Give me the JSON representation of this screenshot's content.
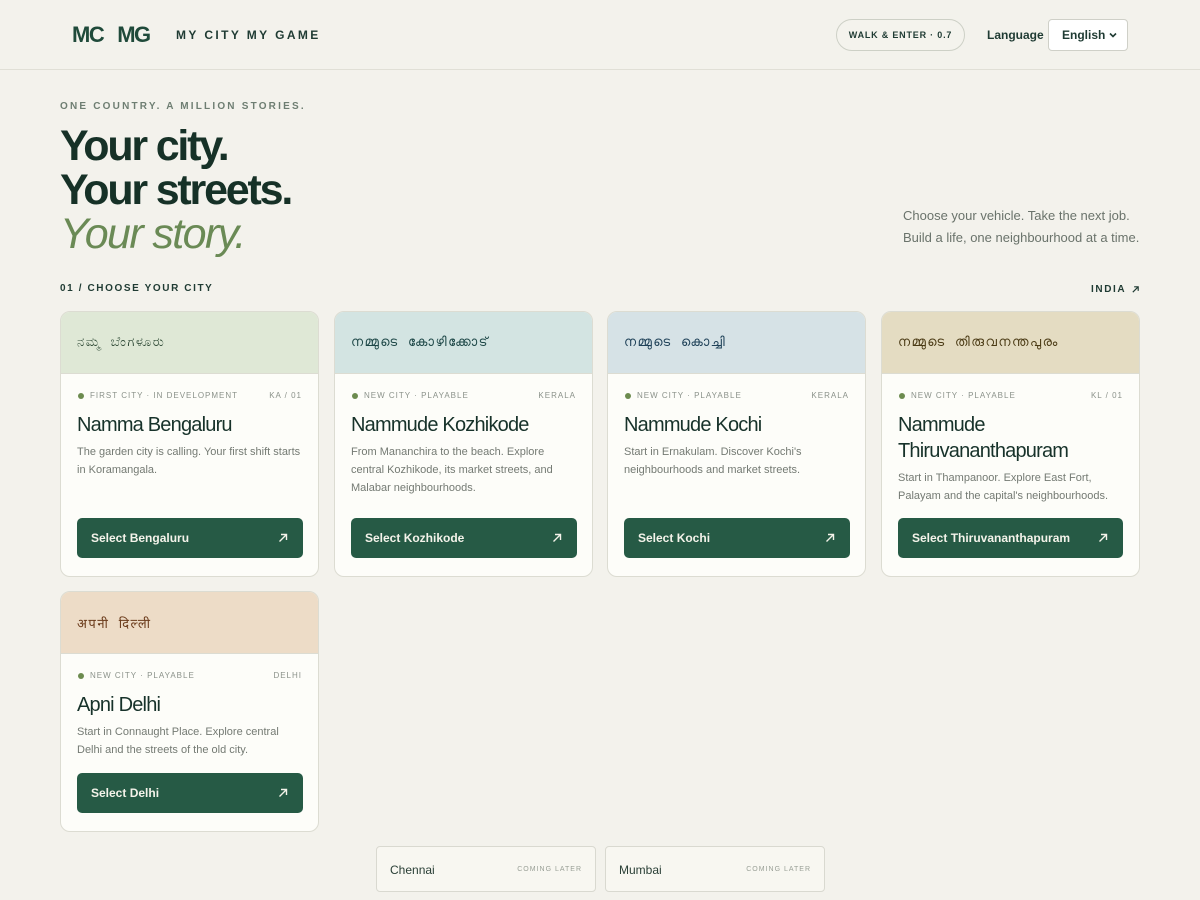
{
  "header": {
    "logo_left": "MC",
    "logo_right": "MG",
    "brand": "MY CITY MY GAME",
    "status_pill": "WALK & ENTER · 0.7",
    "language_label": "Language",
    "language_value": "English"
  },
  "hero": {
    "kicker": "ONE COUNTRY. A MILLION STORIES.",
    "line1": "Your city.",
    "line2": "Your streets.",
    "line3": "Your story.",
    "blurb_line1": "Choose your vehicle. Take the next job.",
    "blurb_line2": "Build a life, one neighbourhood at a time."
  },
  "section": {
    "label": "01 / CHOOSE YOUR CITY",
    "link": "INDIA"
  },
  "cities": [
    {
      "script": "ನಮ್ಮ ಬೆಂಗಳೂರು",
      "tag": "FIRST CITY · IN DEVELOPMENT",
      "code": "KA / 01",
      "name": "Namma Bengaluru",
      "desc": "The garden city is calling. Your first shift starts in Koramangala.",
      "button": "Select Bengaluru",
      "band_color": "#dfe8d6",
      "script_color": "#2f4a36"
    },
    {
      "script": "നമ്മുടെ കോഴിക്കോട്",
      "tag": "NEW CITY · PLAYABLE",
      "code": "KERALA",
      "name": "Nammude Kozhikode",
      "desc": "From Mananchira to the beach. Explore central Kozhikode, its market streets, and Malabar neighbourhoods.",
      "button": "Select Kozhikode",
      "band_color": "#d3e4e2",
      "script_color": "#1d4747"
    },
    {
      "script": "നമ്മുടെ കൊച്ചി",
      "tag": "NEW CITY · PLAYABLE",
      "code": "KERALA",
      "name": "Nammude Kochi",
      "desc": "Start in Ernakulam. Discover Kochi's neighbourhoods and market streets.",
      "button": "Select Kochi",
      "band_color": "#d6e2e6",
      "script_color": "#1f4158"
    },
    {
      "script": "നമ്മുടെ തിരുവനന്തപുരം",
      "tag": "NEW CITY · PLAYABLE",
      "code": "KL / 01",
      "name": "Nammude Thiruvananthapuram",
      "desc": "Start in Thampanoor. Explore East Fort, Palayam and the capital's neighbourhoods.",
      "button": "Select Thiruvananthapuram",
      "band_color": "#e4dcc2",
      "script_color": "#4a3a14"
    },
    {
      "script": "अपनी दिल्ली",
      "tag": "NEW CITY · PLAYABLE",
      "code": "DELHI",
      "name": "Apni Delhi",
      "desc": "Start in Connaught Place. Explore central Delhi and the streets of the old city.",
      "button": "Select Delhi",
      "band_color": "#eddcc7",
      "script_color": "#6a3a1a"
    }
  ],
  "coming": [
    {
      "name": "Chennai",
      "status": "COMING LATER"
    },
    {
      "name": "Mumbai",
      "status": "COMING LATER"
    }
  ],
  "colors": {
    "background": "#f3f2ec",
    "primary_button": "#265a45",
    "accent_green": "#6a8a55"
  },
  "icons": {
    "card_button": "arrow-up-right-icon",
    "language": "chevron-down-icon"
  }
}
